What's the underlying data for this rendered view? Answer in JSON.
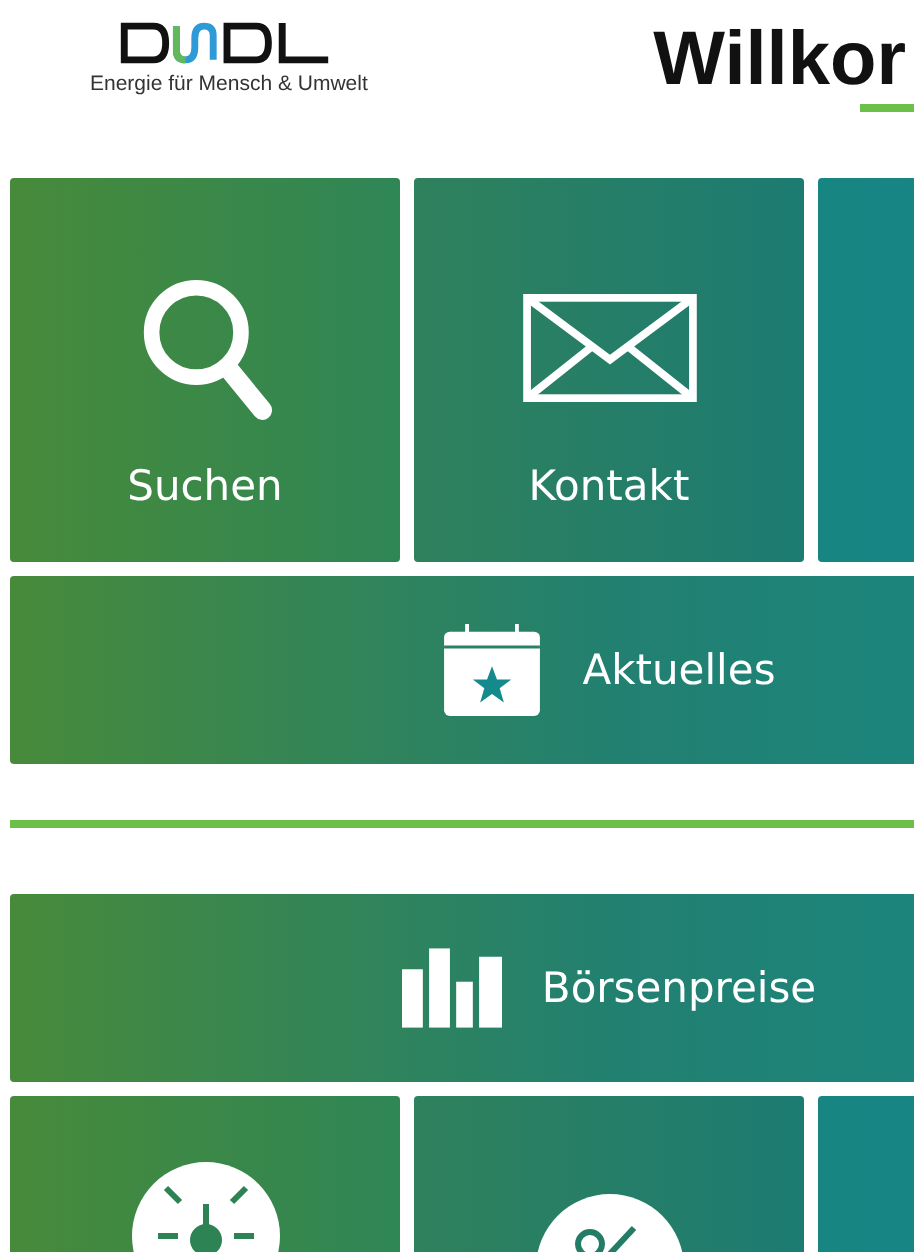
{
  "header": {
    "tagline": "Energie für Mensch & Umwelt",
    "title": "Willkor"
  },
  "sections": [
    {
      "rows": [
        {
          "kind": "grid",
          "tiles": [
            {
              "kind": "search",
              "label": "Suchen"
            },
            {
              "kind": "mail",
              "label": "Kontakt"
            },
            {
              "kind": "empty"
            }
          ]
        },
        {
          "kind": "wide",
          "tiles": [
            {
              "kind": "calendar",
              "label": "Aktuelles"
            }
          ]
        }
      ]
    },
    {
      "rows": [
        {
          "kind": "wide",
          "tiles": [
            {
              "kind": "bars",
              "label": "Börsenpreise"
            }
          ]
        },
        {
          "kind": "grid",
          "tiles": [
            {
              "kind": "gauge"
            },
            {
              "kind": "percent"
            },
            {
              "kind": "empty"
            }
          ]
        }
      ]
    }
  ]
}
